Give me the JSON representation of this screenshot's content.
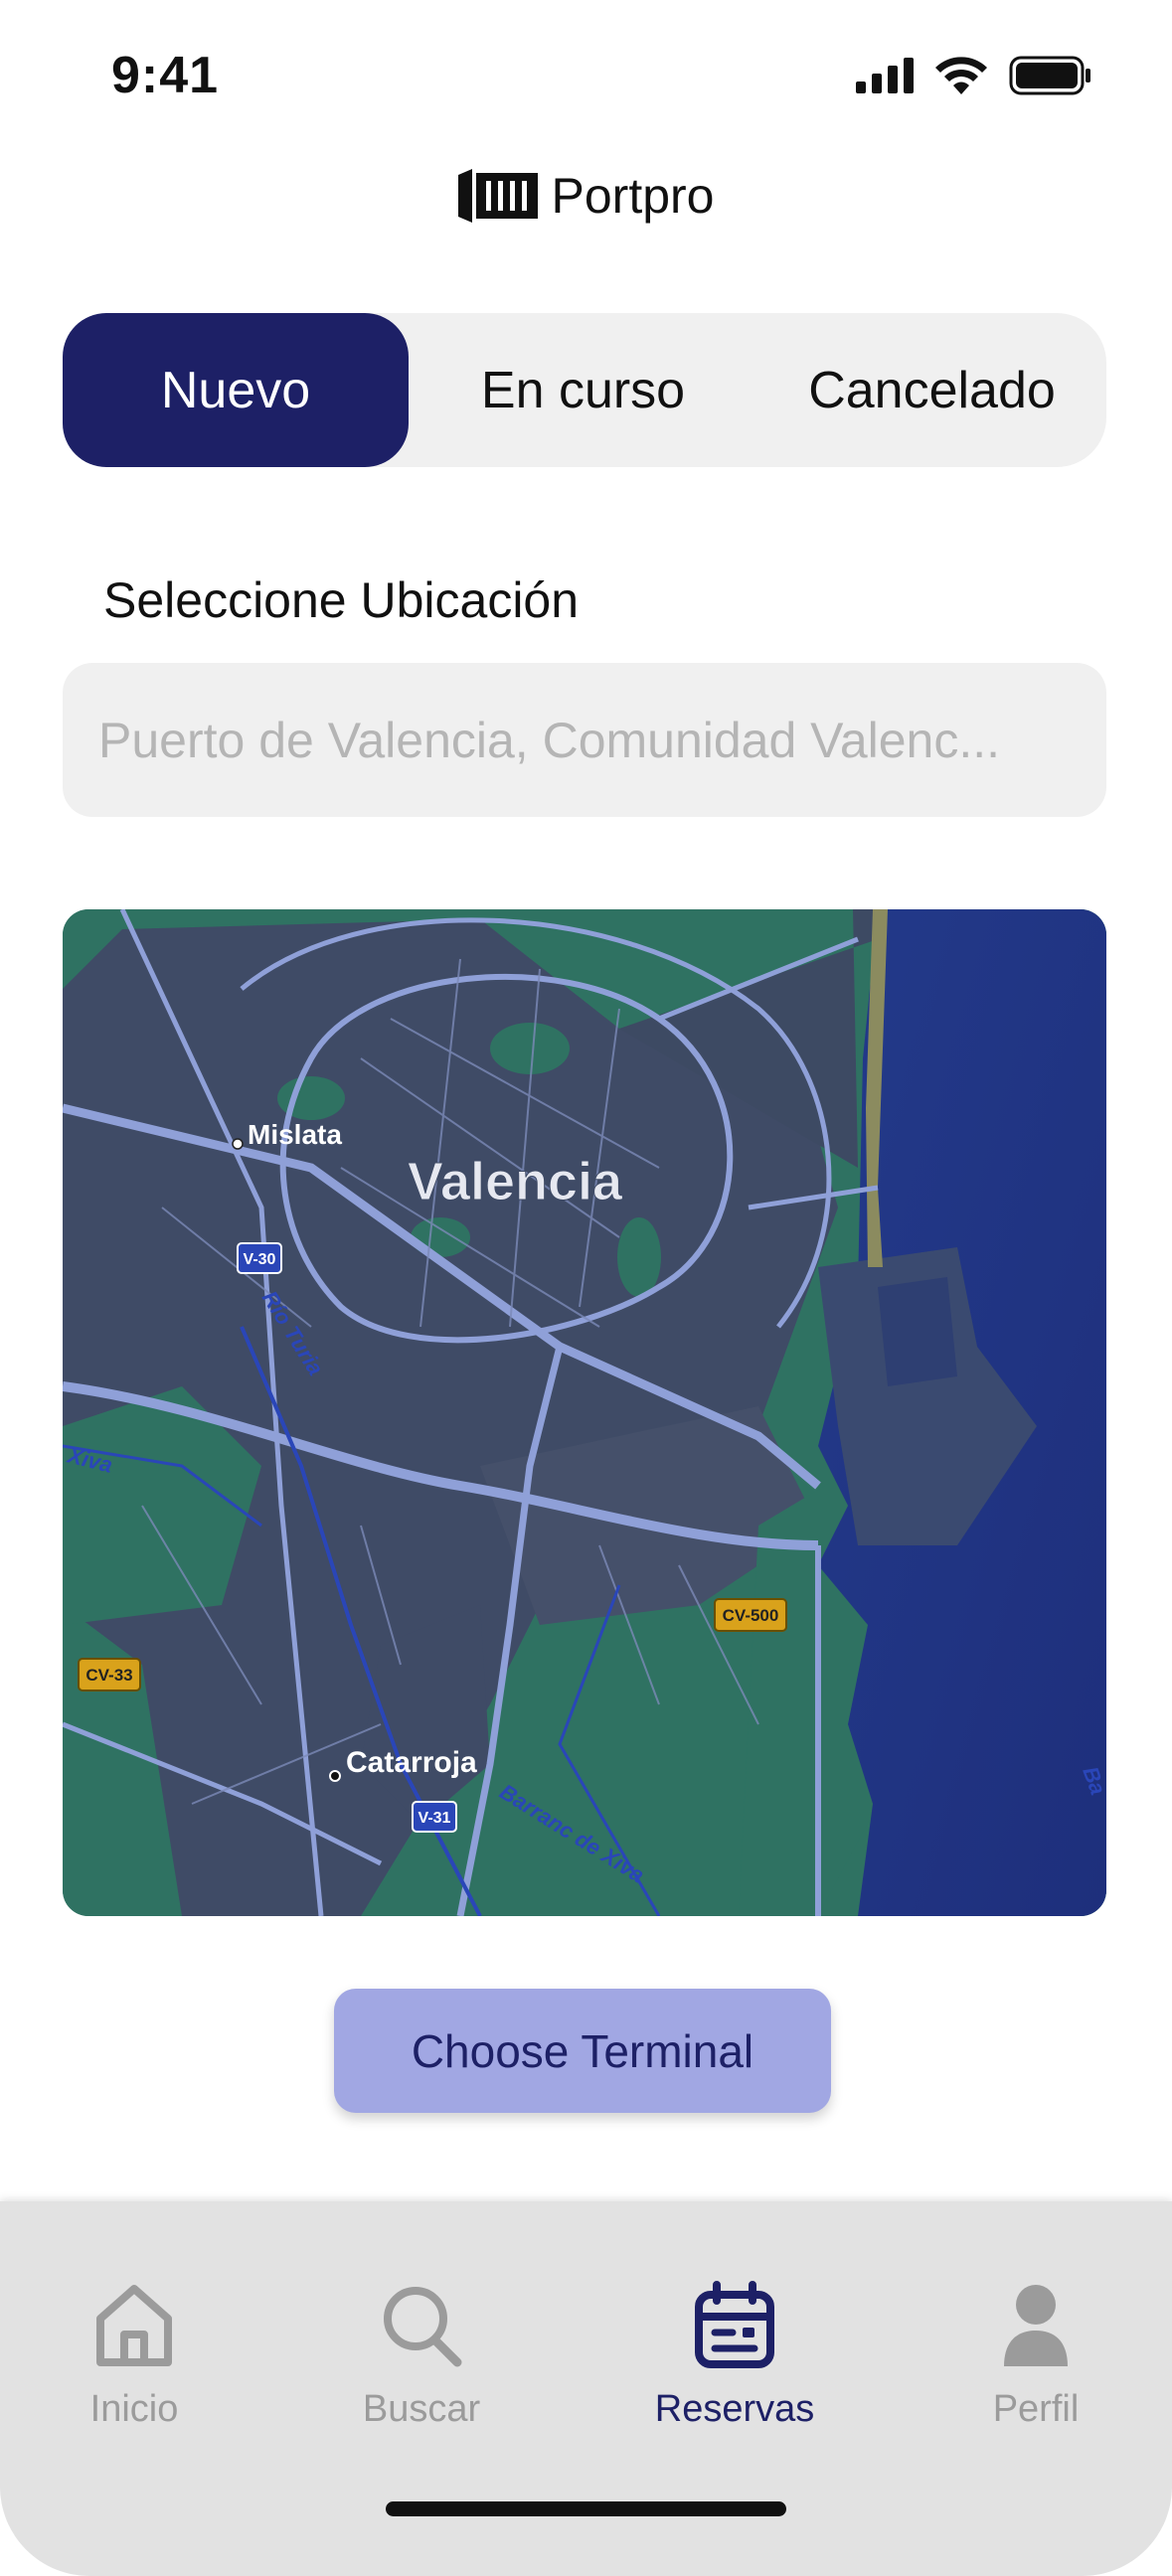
{
  "status_bar": {
    "time": "9:41",
    "icons": [
      "signal-icon",
      "wifi-icon",
      "battery-icon"
    ]
  },
  "brand": {
    "name": "Portpro",
    "logo_icon": "container-icon"
  },
  "tabs": [
    {
      "label": "Nuevo",
      "active": true
    },
    {
      "label": "En curso",
      "active": false
    },
    {
      "label": "Cancelado",
      "active": false
    }
  ],
  "location": {
    "label": "Seleccione Ubicación",
    "placeholder": "Puerto de Valencia, Comunidad Valenc..."
  },
  "map": {
    "city_label": "Valencia",
    "places": [
      "Mislata",
      "Catarroja"
    ],
    "road_shields": [
      "V-30",
      "CV-33",
      "CV-500",
      "V-31"
    ],
    "water_labels": [
      "Río Turia",
      "Barranc de Xiva",
      "Xiva",
      "Ba"
    ]
  },
  "cta": {
    "label": "Choose Terminal"
  },
  "bottom_nav": [
    {
      "label": "Inicio",
      "icon": "home-icon",
      "active": false
    },
    {
      "label": "Buscar",
      "icon": "search-icon",
      "active": false
    },
    {
      "label": "Reservas",
      "icon": "calendar-icon",
      "active": true
    },
    {
      "label": "Perfil",
      "icon": "user-icon",
      "active": false
    }
  ],
  "colors": {
    "primary": "#1d2066",
    "button": "#a1a7e3",
    "inactive": "#9b9b9b",
    "surface": "#f0f0f0"
  }
}
